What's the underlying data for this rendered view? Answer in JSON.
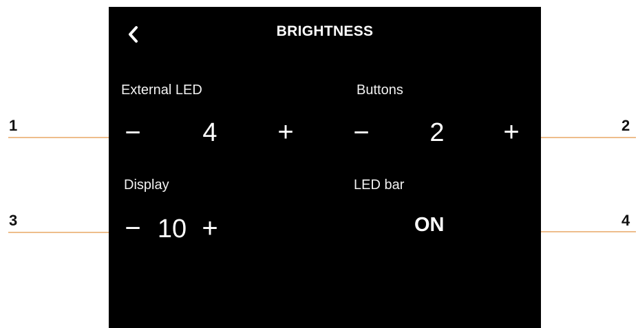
{
  "header": {
    "title": "BRIGHTNESS",
    "back_icon": "chevron-left-icon"
  },
  "controls": {
    "external_led": {
      "label": "External LED",
      "value": "4",
      "minus": "−",
      "plus": "+"
    },
    "buttons": {
      "label": "Buttons",
      "value": "2",
      "minus": "−",
      "plus": "+"
    },
    "display": {
      "label": "Display",
      "value": "10",
      "minus": "−",
      "plus": "+"
    },
    "led_bar": {
      "label": "LED bar",
      "value": "ON"
    }
  },
  "callouts": [
    "1",
    "2",
    "3",
    "4"
  ],
  "colors": {
    "screen": "#000000",
    "text": "#ffffff",
    "leader_orange": "#f0b070"
  }
}
